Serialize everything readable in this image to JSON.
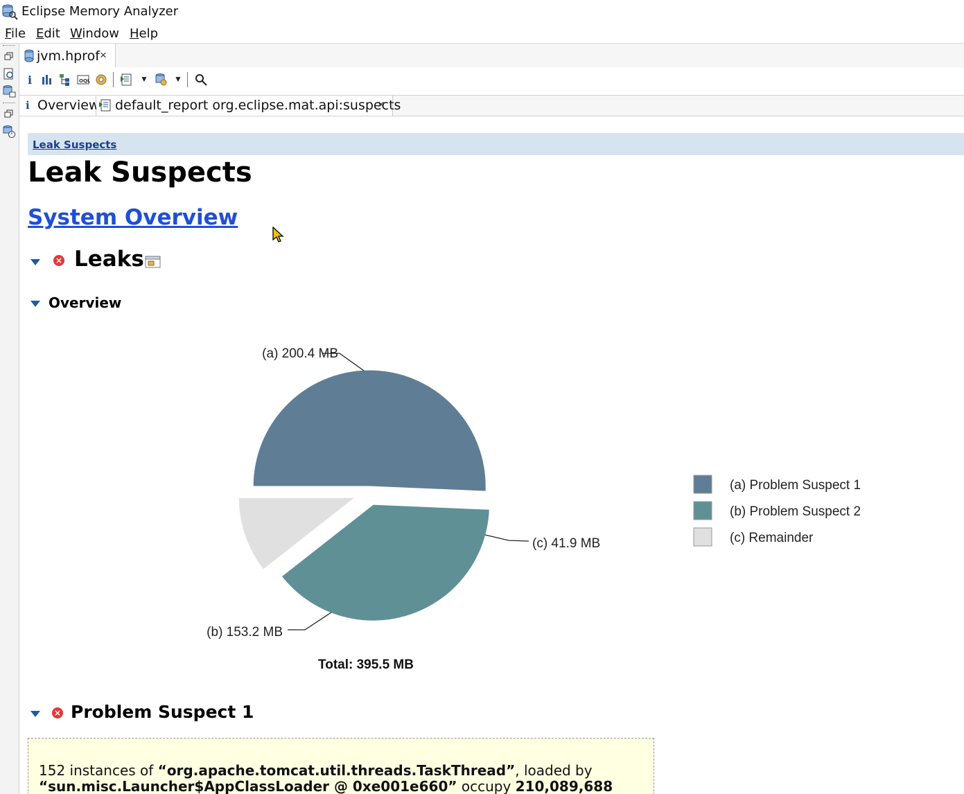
{
  "window": {
    "title": "Eclipse Memory Analyzer"
  },
  "menu": [
    {
      "label": "File",
      "mnemonic": "F",
      "rest": "ile"
    },
    {
      "label": "Edit",
      "mnemonic": "E",
      "rest": "dit"
    },
    {
      "label": "Window",
      "mnemonic": "W",
      "rest": "indow"
    },
    {
      "label": "Help",
      "mnemonic": "H",
      "rest": "elp"
    }
  ],
  "editor_tab": {
    "label": "jvm.hprof",
    "close": "×"
  },
  "result_tabs": [
    {
      "icon": "info-icon",
      "label": "Overview"
    },
    {
      "icon": "report-icon",
      "label": "default_report  org.eclipse.mat.api:suspects",
      "close": "×"
    }
  ],
  "breadcrumb": "Leak Suspects",
  "page_title": "Leak Suspects",
  "system_overview_link": "System Overview",
  "leaks_heading": "Leaks",
  "overview_heading": "Overview",
  "chart_data": {
    "type": "pie",
    "slices": [
      {
        "id": "(a)",
        "label": "Problem Suspect 1",
        "value": 200.4,
        "display": "200.4 MB",
        "color": "#5f7e95"
      },
      {
        "id": "(b)",
        "label": "Problem Suspect 2",
        "value": 153.2,
        "display": "153.2 MB",
        "color": "#5f9096"
      },
      {
        "id": "(c)",
        "label": "Remainder",
        "value": 41.9,
        "display": "41.9 MB",
        "color": "#e0e0e0"
      }
    ],
    "total_label": "Total: 395.5 MB",
    "legend_position": "right"
  },
  "problem_suspect_heading": "Problem Suspect 1",
  "problem_suspect_text": {
    "prefix": "152 instances of ",
    "class_name": "“org.apache.tomcat.util.threads.TaskThread”",
    "middle": ", loaded by",
    "loader": "“sun.misc.Launcher$AppClassLoader @ 0xe001e660”",
    "occupy": " occupy ",
    "bytes": "210,089,688"
  }
}
